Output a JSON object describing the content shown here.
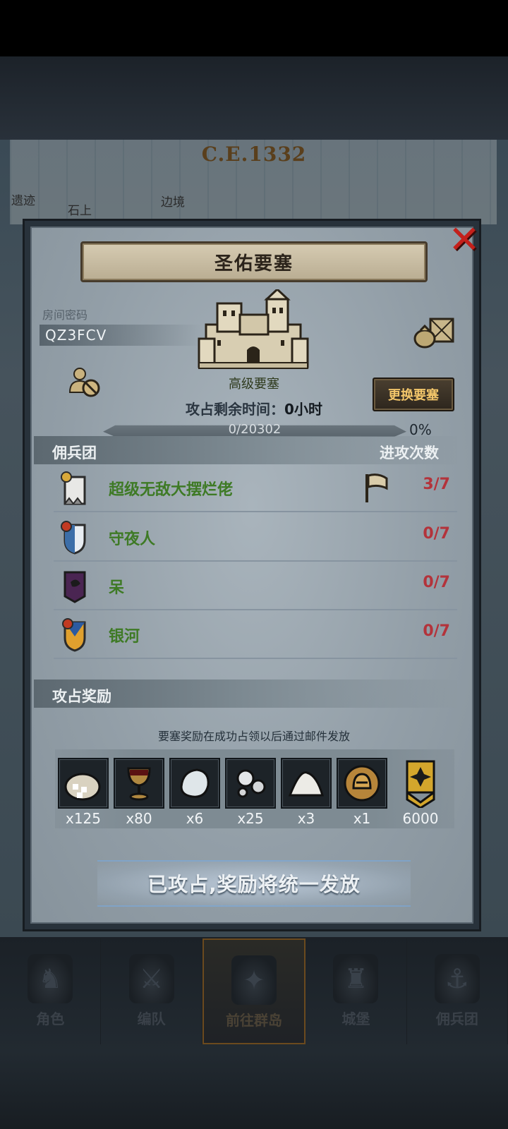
{
  "background": {
    "year": "C.E.1332",
    "map_labels": [
      "遗迹",
      "石上",
      "边境"
    ]
  },
  "dialog": {
    "title": "圣佑要塞",
    "room_password_label": "房间密码",
    "room_password_value": "QZ3FCV",
    "fortress_type": "高级要塞",
    "change_button": "更换要塞",
    "remaining_time_label": "攻占剩余时间：",
    "remaining_time_value": "0小时",
    "progress_text": "0/20302",
    "progress_percent": "0%",
    "progress_fraction": 0,
    "mercenary_header": "佣兵团",
    "attack_count_header": "进攻次数",
    "mercenaries": [
      {
        "name": "超级无敌大摆烂佬",
        "count": "3/7",
        "emblem": "white-banner-emblem",
        "flag": true
      },
      {
        "name": "守夜人",
        "count": "0/7",
        "emblem": "blue-white-shield-emblem",
        "flag": false
      },
      {
        "name": "呆",
        "count": "0/7",
        "emblem": "purple-dark-banner-emblem",
        "flag": false
      },
      {
        "name": "银河",
        "count": "0/7",
        "emblem": "blue-gold-shield-emblem",
        "flag": false
      }
    ],
    "reward_header": "攻占奖励",
    "reward_note": "要塞奖励在成功占领以后通过邮件发放",
    "rewards": [
      {
        "icon": "sugar-sack-icon",
        "qty": "x125"
      },
      {
        "icon": "goblet-icon",
        "qty": "x80"
      },
      {
        "icon": "pearl-stone-icon",
        "qty": "x6"
      },
      {
        "icon": "silver-pearls-icon",
        "qty": "x25"
      },
      {
        "icon": "salt-pile-icon",
        "qty": "x3"
      },
      {
        "icon": "helmet-medal-icon",
        "qty": "x1"
      },
      {
        "icon": "rank-badge-icon",
        "qty": "6000"
      }
    ],
    "status_banner": "已攻占,奖励将统一发放"
  },
  "nav": [
    {
      "label": "角色",
      "icon": "knight-icon",
      "active": false
    },
    {
      "label": "编队",
      "icon": "squad-icon",
      "active": false
    },
    {
      "label": "前往群岛",
      "icon": "compass-map-icon",
      "active": true
    },
    {
      "label": "城堡",
      "icon": "castle-icon",
      "active": false
    },
    {
      "label": "佣兵团",
      "icon": "ship-icon",
      "active": false
    }
  ],
  "colors": {
    "name_green": "#3e7a25",
    "count_red": "#b3333b",
    "close_red": "#c4201b",
    "button_gold": "#f3c66a"
  }
}
